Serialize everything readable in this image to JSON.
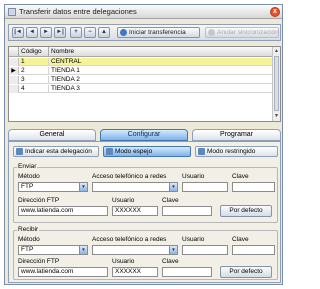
{
  "window": {
    "title": "Transferir datos entre delegaciones",
    "close_glyph": "x"
  },
  "toolbar": {
    "nav": [
      "|◄",
      "◄",
      "►",
      "►|",
      "+",
      "−",
      "▲"
    ],
    "start_label": "Iniciar transferencia",
    "cancel_label": "Anular sincronización"
  },
  "grid": {
    "headers": {
      "code": "Código",
      "name": "Nombre"
    },
    "rows": [
      {
        "marker": "",
        "code": "1",
        "name": "CENTRAL"
      },
      {
        "marker": "▶",
        "code": "2",
        "name": "TIENDA 1"
      },
      {
        "marker": "",
        "code": "3",
        "name": "TIENDA 2"
      },
      {
        "marker": "",
        "code": "4",
        "name": "TIENDA 3"
      }
    ]
  },
  "tabs": {
    "general": "General",
    "configure": "Configurar",
    "schedule": "Programar"
  },
  "modes": {
    "indicate": "Indicar esta delegación",
    "mirror": "Modo espejo",
    "restricted": "Modo restringido"
  },
  "send": {
    "title": "Enviar",
    "method_label": "Método",
    "method_value": "FTP",
    "phone_label": "Acceso telefónico a redes",
    "phone_value": "",
    "user_label": "Usuario",
    "user_value": "",
    "pass_label": "Clave",
    "pass_value": "",
    "ftp_label": "Dirección FTP",
    "ftp_value": "www.latienda.com",
    "user2_label": "Usuario",
    "user2_value": "XXXXXX",
    "pass2_label": "Clave",
    "pass2_value": "",
    "default_label": "Por defecto"
  },
  "receive": {
    "title": "Recibir",
    "method_label": "Método",
    "method_value": "FTP",
    "phone_label": "Acceso telefónico a redes",
    "phone_value": "",
    "user_label": "Usuario",
    "user_value": "",
    "pass_label": "Clave",
    "pass_value": "",
    "ftp_label": "Dirección FTP",
    "ftp_value": "www.latienda.com",
    "user2_label": "Usuario",
    "user2_value": "XXXXXX",
    "pass2_label": "Clave",
    "pass2_value": "",
    "default_label": "Por defecto"
  },
  "colors": {
    "selected_row": "#f5f39a",
    "active_tab": "#7fb2ea",
    "close": "#e8532a"
  }
}
